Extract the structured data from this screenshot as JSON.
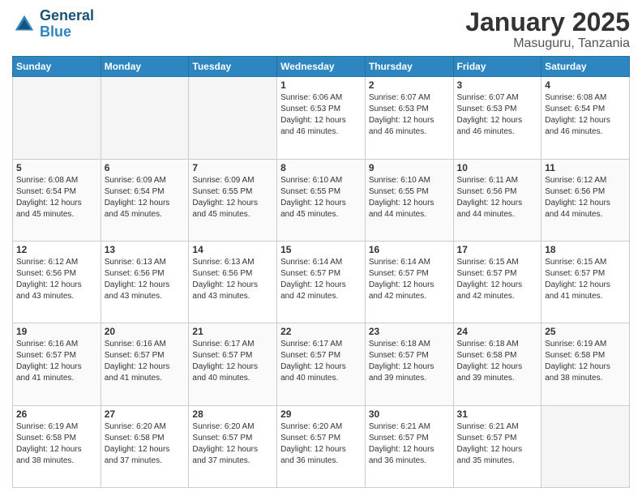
{
  "header": {
    "logo_line1": "General",
    "logo_line2": "Blue",
    "month": "January 2025",
    "location": "Masuguru, Tanzania"
  },
  "weekdays": [
    "Sunday",
    "Monday",
    "Tuesday",
    "Wednesday",
    "Thursday",
    "Friday",
    "Saturday"
  ],
  "weeks": [
    [
      {
        "day": "",
        "info": ""
      },
      {
        "day": "",
        "info": ""
      },
      {
        "day": "",
        "info": ""
      },
      {
        "day": "1",
        "info": "Sunrise: 6:06 AM\nSunset: 6:53 PM\nDaylight: 12 hours\nand 46 minutes."
      },
      {
        "day": "2",
        "info": "Sunrise: 6:07 AM\nSunset: 6:53 PM\nDaylight: 12 hours\nand 46 minutes."
      },
      {
        "day": "3",
        "info": "Sunrise: 6:07 AM\nSunset: 6:53 PM\nDaylight: 12 hours\nand 46 minutes."
      },
      {
        "day": "4",
        "info": "Sunrise: 6:08 AM\nSunset: 6:54 PM\nDaylight: 12 hours\nand 46 minutes."
      }
    ],
    [
      {
        "day": "5",
        "info": "Sunrise: 6:08 AM\nSunset: 6:54 PM\nDaylight: 12 hours\nand 45 minutes."
      },
      {
        "day": "6",
        "info": "Sunrise: 6:09 AM\nSunset: 6:54 PM\nDaylight: 12 hours\nand 45 minutes."
      },
      {
        "day": "7",
        "info": "Sunrise: 6:09 AM\nSunset: 6:55 PM\nDaylight: 12 hours\nand 45 minutes."
      },
      {
        "day": "8",
        "info": "Sunrise: 6:10 AM\nSunset: 6:55 PM\nDaylight: 12 hours\nand 45 minutes."
      },
      {
        "day": "9",
        "info": "Sunrise: 6:10 AM\nSunset: 6:55 PM\nDaylight: 12 hours\nand 44 minutes."
      },
      {
        "day": "10",
        "info": "Sunrise: 6:11 AM\nSunset: 6:56 PM\nDaylight: 12 hours\nand 44 minutes."
      },
      {
        "day": "11",
        "info": "Sunrise: 6:12 AM\nSunset: 6:56 PM\nDaylight: 12 hours\nand 44 minutes."
      }
    ],
    [
      {
        "day": "12",
        "info": "Sunrise: 6:12 AM\nSunset: 6:56 PM\nDaylight: 12 hours\nand 43 minutes."
      },
      {
        "day": "13",
        "info": "Sunrise: 6:13 AM\nSunset: 6:56 PM\nDaylight: 12 hours\nand 43 minutes."
      },
      {
        "day": "14",
        "info": "Sunrise: 6:13 AM\nSunset: 6:56 PM\nDaylight: 12 hours\nand 43 minutes."
      },
      {
        "day": "15",
        "info": "Sunrise: 6:14 AM\nSunset: 6:57 PM\nDaylight: 12 hours\nand 42 minutes."
      },
      {
        "day": "16",
        "info": "Sunrise: 6:14 AM\nSunset: 6:57 PM\nDaylight: 12 hours\nand 42 minutes."
      },
      {
        "day": "17",
        "info": "Sunrise: 6:15 AM\nSunset: 6:57 PM\nDaylight: 12 hours\nand 42 minutes."
      },
      {
        "day": "18",
        "info": "Sunrise: 6:15 AM\nSunset: 6:57 PM\nDaylight: 12 hours\nand 41 minutes."
      }
    ],
    [
      {
        "day": "19",
        "info": "Sunrise: 6:16 AM\nSunset: 6:57 PM\nDaylight: 12 hours\nand 41 minutes."
      },
      {
        "day": "20",
        "info": "Sunrise: 6:16 AM\nSunset: 6:57 PM\nDaylight: 12 hours\nand 41 minutes."
      },
      {
        "day": "21",
        "info": "Sunrise: 6:17 AM\nSunset: 6:57 PM\nDaylight: 12 hours\nand 40 minutes."
      },
      {
        "day": "22",
        "info": "Sunrise: 6:17 AM\nSunset: 6:57 PM\nDaylight: 12 hours\nand 40 minutes."
      },
      {
        "day": "23",
        "info": "Sunrise: 6:18 AM\nSunset: 6:57 PM\nDaylight: 12 hours\nand 39 minutes."
      },
      {
        "day": "24",
        "info": "Sunrise: 6:18 AM\nSunset: 6:58 PM\nDaylight: 12 hours\nand 39 minutes."
      },
      {
        "day": "25",
        "info": "Sunrise: 6:19 AM\nSunset: 6:58 PM\nDaylight: 12 hours\nand 38 minutes."
      }
    ],
    [
      {
        "day": "26",
        "info": "Sunrise: 6:19 AM\nSunset: 6:58 PM\nDaylight: 12 hours\nand 38 minutes."
      },
      {
        "day": "27",
        "info": "Sunrise: 6:20 AM\nSunset: 6:58 PM\nDaylight: 12 hours\nand 37 minutes."
      },
      {
        "day": "28",
        "info": "Sunrise: 6:20 AM\nSunset: 6:57 PM\nDaylight: 12 hours\nand 37 minutes."
      },
      {
        "day": "29",
        "info": "Sunrise: 6:20 AM\nSunset: 6:57 PM\nDaylight: 12 hours\nand 36 minutes."
      },
      {
        "day": "30",
        "info": "Sunrise: 6:21 AM\nSunset: 6:57 PM\nDaylight: 12 hours\nand 36 minutes."
      },
      {
        "day": "31",
        "info": "Sunrise: 6:21 AM\nSunset: 6:57 PM\nDaylight: 12 hours\nand 35 minutes."
      },
      {
        "day": "",
        "info": ""
      }
    ]
  ]
}
